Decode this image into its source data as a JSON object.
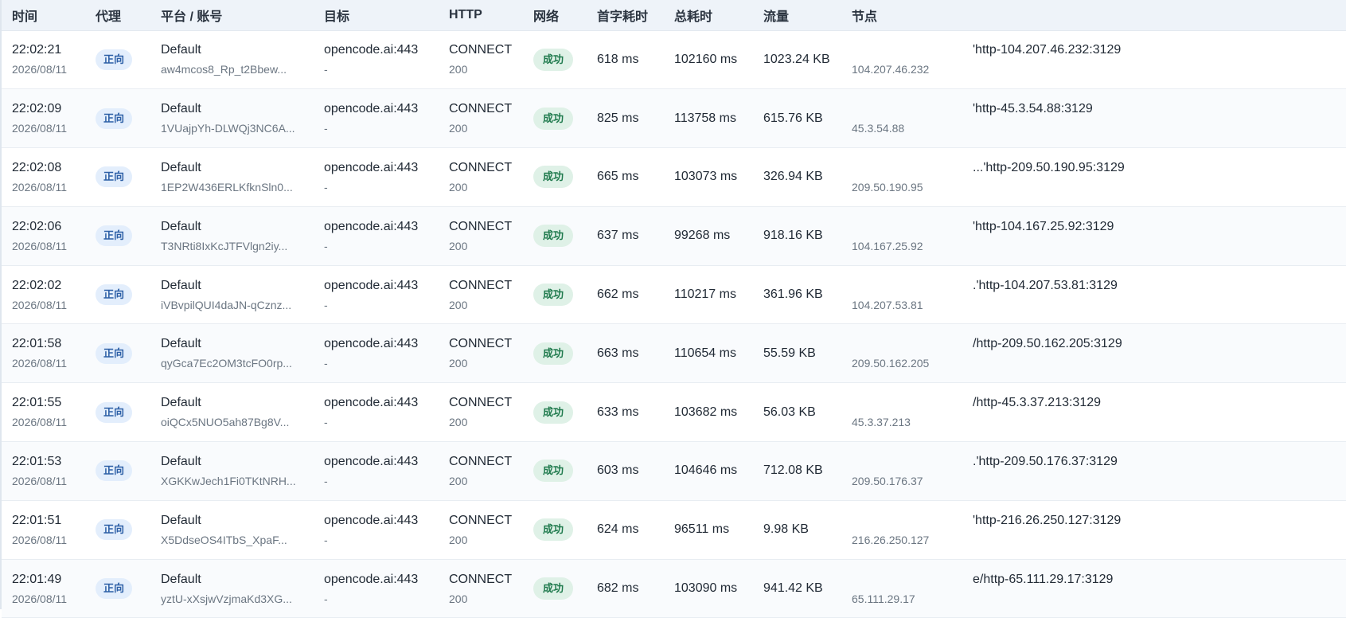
{
  "headers": [
    "时间",
    "代理",
    "平台 / 账号",
    "目标",
    "HTTP",
    "网络",
    "首字耗时",
    "总耗时",
    "流量",
    "节点"
  ],
  "rows": [
    {
      "time": "22:02:21",
      "date": "2026/08/11",
      "proxy": "正向",
      "platform": "Default",
      "account": "aw4mcos8_Rp_t2Bbew...",
      "target": "opencode.ai:443",
      "target_sub": "-",
      "method": "CONNECT",
      "status": "200",
      "network": "成功",
      "first_byte": "618 ms",
      "total": "102160 ms",
      "traffic": "1023.24 KB",
      "node": "'http-104.207.46.232:3129",
      "node_ip": "104.207.46.232"
    },
    {
      "time": "22:02:09",
      "date": "2026/08/11",
      "proxy": "正向",
      "platform": "Default",
      "account": "1VUajpYh-DLWQj3NC6A...",
      "target": "opencode.ai:443",
      "target_sub": "-",
      "method": "CONNECT",
      "status": "200",
      "network": "成功",
      "first_byte": "825 ms",
      "total": "113758 ms",
      "traffic": "615.76 KB",
      "node": "'http-45.3.54.88:3129",
      "node_ip": "45.3.54.88"
    },
    {
      "time": "22:02:08",
      "date": "2026/08/11",
      "proxy": "正向",
      "platform": "Default",
      "account": "1EP2W436ERLKfknSln0...",
      "target": "opencode.ai:443",
      "target_sub": "-",
      "method": "CONNECT",
      "status": "200",
      "network": "成功",
      "first_byte": "665 ms",
      "total": "103073 ms",
      "traffic": "326.94 KB",
      "node": "...'http-209.50.190.95:3129",
      "node_ip": "209.50.190.95"
    },
    {
      "time": "22:02:06",
      "date": "2026/08/11",
      "proxy": "正向",
      "platform": "Default",
      "account": "T3NRti8IxKcJTFVlgn2iy...",
      "target": "opencode.ai:443",
      "target_sub": "-",
      "method": "CONNECT",
      "status": "200",
      "network": "成功",
      "first_byte": "637 ms",
      "total": "99268 ms",
      "traffic": "918.16 KB",
      "node": "'http-104.167.25.92:3129",
      "node_ip": "104.167.25.92"
    },
    {
      "time": "22:02:02",
      "date": "2026/08/11",
      "proxy": "正向",
      "platform": "Default",
      "account": "iVBvpilQUI4daJN-qCznz...",
      "target": "opencode.ai:443",
      "target_sub": "-",
      "method": "CONNECT",
      "status": "200",
      "network": "成功",
      "first_byte": "662 ms",
      "total": "110217 ms",
      "traffic": "361.96 KB",
      "node": ".'http-104.207.53.81:3129",
      "node_ip": "104.207.53.81"
    },
    {
      "time": "22:01:58",
      "date": "2026/08/11",
      "proxy": "正向",
      "platform": "Default",
      "account": "qyGca7Ec2OM3tcFO0rp...",
      "target": "opencode.ai:443",
      "target_sub": "-",
      "method": "CONNECT",
      "status": "200",
      "network": "成功",
      "first_byte": "663 ms",
      "total": "110654 ms",
      "traffic": "55.59 KB",
      "node": "/http-209.50.162.205:3129",
      "node_ip": "209.50.162.205"
    },
    {
      "time": "22:01:55",
      "date": "2026/08/11",
      "proxy": "正向",
      "platform": "Default",
      "account": "oiQCx5NUO5ah87Bg8V...",
      "target": "opencode.ai:443",
      "target_sub": "-",
      "method": "CONNECT",
      "status": "200",
      "network": "成功",
      "first_byte": "633 ms",
      "total": "103682 ms",
      "traffic": "56.03 KB",
      "node": "/http-45.3.37.213:3129",
      "node_ip": "45.3.37.213"
    },
    {
      "time": "22:01:53",
      "date": "2026/08/11",
      "proxy": "正向",
      "platform": "Default",
      "account": "XGKKwJech1Fi0TKtNRH...",
      "target": "opencode.ai:443",
      "target_sub": "-",
      "method": "CONNECT",
      "status": "200",
      "network": "成功",
      "first_byte": "603 ms",
      "total": "104646 ms",
      "traffic": "712.08 KB",
      "node": ".'http-209.50.176.37:3129",
      "node_ip": "209.50.176.37"
    },
    {
      "time": "22:01:51",
      "date": "2026/08/11",
      "proxy": "正向",
      "platform": "Default",
      "account": "X5DdseOS4ITbS_XpaF...",
      "target": "opencode.ai:443",
      "target_sub": "-",
      "method": "CONNECT",
      "status": "200",
      "network": "成功",
      "first_byte": "624 ms",
      "total": "96511 ms",
      "traffic": "9.98 KB",
      "node": "'http-216.26.250.127:3129",
      "node_ip": "216.26.250.127"
    },
    {
      "time": "22:01:49",
      "date": "2026/08/11",
      "proxy": "正向",
      "platform": "Default",
      "account": "yztU-xXsjwVzjmaKd3XG...",
      "target": "opencode.ai:443",
      "target_sub": "-",
      "method": "CONNECT",
      "status": "200",
      "network": "成功",
      "first_byte": "682 ms",
      "total": "103090 ms",
      "traffic": "941.42 KB",
      "node": "e/http-65.111.29.17:3129",
      "node_ip": "65.111.29.17"
    }
  ]
}
